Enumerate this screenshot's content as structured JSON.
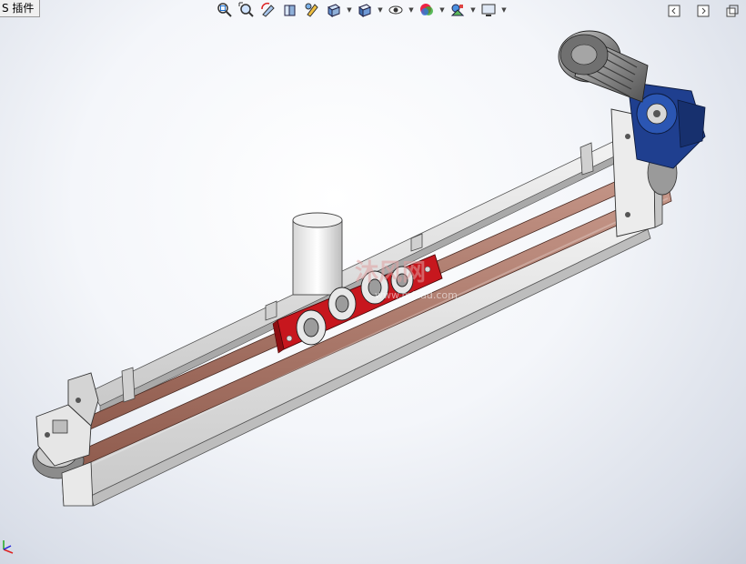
{
  "plugin_tab": {
    "label": "S 插件"
  },
  "toolbar": {
    "icons": [
      "zoom-to-fit-icon",
      "zoom-to-area-icon",
      "previous-view-icon",
      "section-view-icon",
      "dynamic-annotation-icon",
      "view-orientation-icon",
      "display-style-icon",
      "hide-show-items-icon",
      "edit-appearance-icon",
      "apply-scene-icon",
      "view-settings-icon"
    ]
  },
  "window_controls": {
    "icons": [
      "tile-left-icon",
      "tile-right-icon",
      "restore-icon"
    ]
  },
  "watermark": {
    "text": "沐风网",
    "subtext": "www.mfcad.com"
  },
  "colors": {
    "frame": "#e4e4e4",
    "belt": "#b58072",
    "carriage": "#c7171e",
    "motor_blue": "#1f3f8f",
    "motor_gray": "#9a9a9a"
  }
}
